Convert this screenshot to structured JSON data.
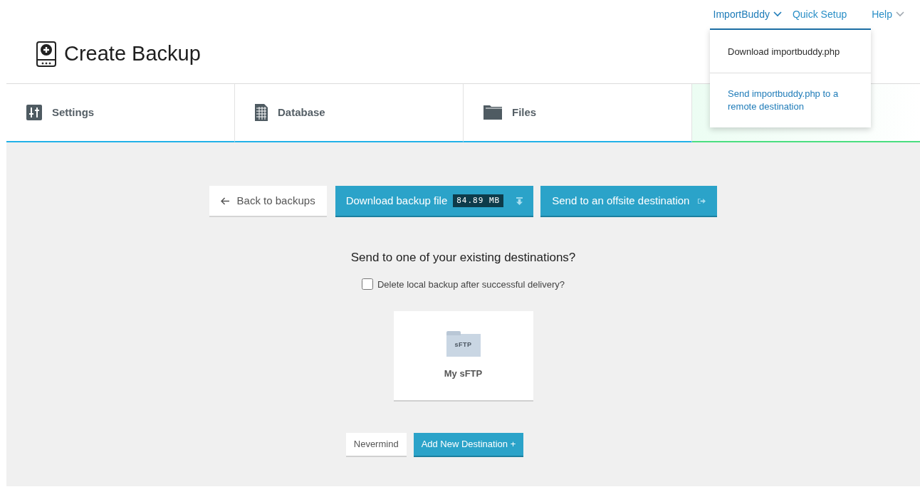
{
  "top_nav": [
    {
      "label": "ImportBuddy",
      "caret": true,
      "open": true
    },
    {
      "label": "Quick Setup",
      "caret": false,
      "open": false
    },
    {
      "label": "Help",
      "caret": true,
      "open": false
    }
  ],
  "dropdown": [
    {
      "label": "Download importbuddy.php",
      "kind": "plain"
    },
    {
      "label": "Send importbuddy.php to a remote destination",
      "kind": "link"
    }
  ],
  "page_title": "Create Backup",
  "tabs": [
    {
      "label": "Settings",
      "kind": "sliders",
      "selected": false
    },
    {
      "label": "Database",
      "kind": "table",
      "selected": false
    },
    {
      "label": "Files",
      "kind": "folder",
      "selected": false
    },
    {
      "selected": true
    }
  ],
  "actions": {
    "back": "Back to backups",
    "download": "Download backup file",
    "size": "84.89 MB",
    "send": "Send to an offsite destination"
  },
  "question": "Send to one of your existing destinations?",
  "delete_local": {
    "label": "Delete local backup after successful delivery?",
    "checked": false
  },
  "destinations": [
    {
      "name": "My sFTP",
      "icon_label": "sFTP"
    }
  ],
  "buttons": {
    "cancel": "Nevermind",
    "add": "Add New Destination +"
  }
}
